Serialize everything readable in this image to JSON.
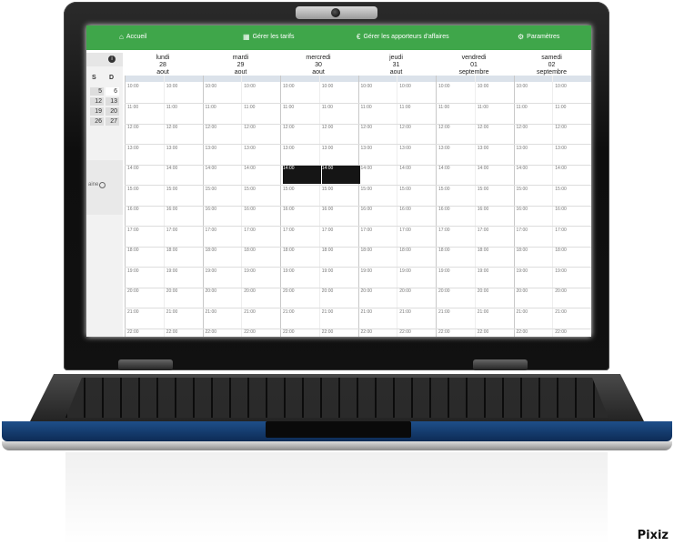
{
  "topnav": {
    "home": {
      "label": "Accueil",
      "icon": "home-icon"
    },
    "tarifs": {
      "label": "Gérer les tarifs",
      "icon": "calendar-icon"
    },
    "apporteurs": {
      "label": "Gérer les apporteurs d'affaires",
      "icon": "euro-icon"
    },
    "params": {
      "label": "Paramètres",
      "icon": "gear-icon"
    },
    "color": "#3fa64a"
  },
  "minical": {
    "days": [
      "S",
      "D"
    ],
    "rows": [
      [
        "5",
        "6"
      ],
      [
        "12",
        "13"
      ],
      [
        "19",
        "20"
      ],
      [
        "26",
        "27"
      ]
    ],
    "week_label": "aine"
  },
  "days": [
    {
      "name": "lundi",
      "num": "28",
      "month": "aout"
    },
    {
      "name": "mardi",
      "num": "29",
      "month": "aout"
    },
    {
      "name": "mercredi",
      "num": "30",
      "month": "aout"
    },
    {
      "name": "jeudi",
      "num": "31",
      "month": "aout"
    },
    {
      "name": "vendredi",
      "num": "01",
      "month": "septembre"
    },
    {
      "name": "samedi",
      "num": "02",
      "month": "septembre"
    }
  ],
  "times": [
    "10:00",
    "11:00",
    "12:00",
    "13:00",
    "14:00",
    "15:00",
    "16:00",
    "17:00",
    "18:00",
    "19:00",
    "20:00",
    "21:00",
    "22:00"
  ],
  "booked_label": "14:00",
  "watermark": "Pixiz"
}
